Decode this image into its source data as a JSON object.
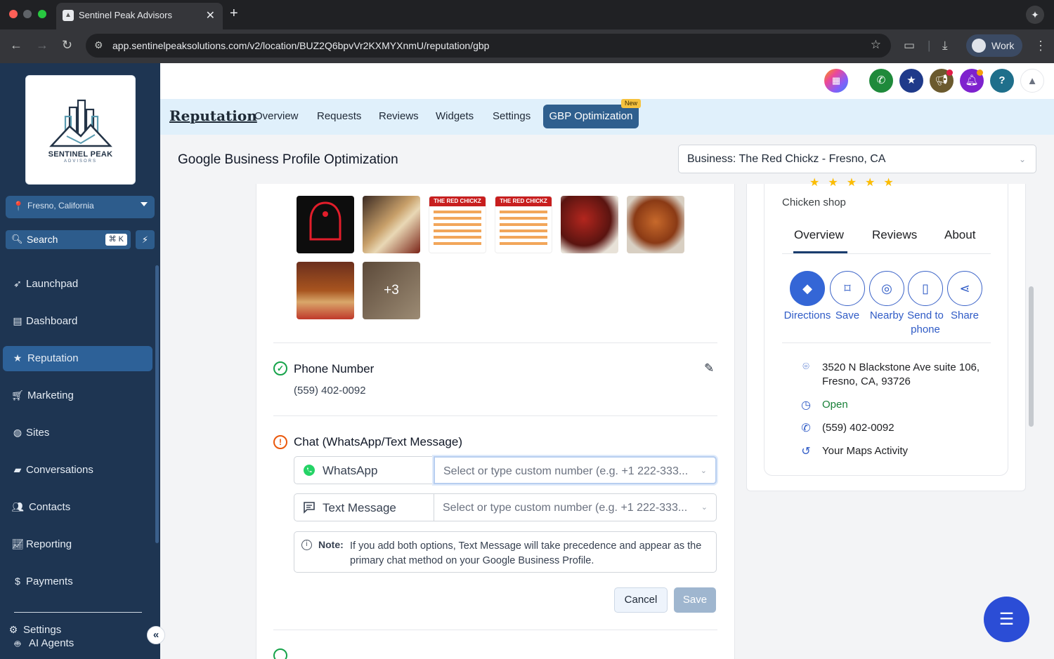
{
  "browser": {
    "tab_title": "Sentinel Peak Advisors",
    "url": "app.sentinelpeaksolutions.com/v2/location/BUZ2Q6bpvVr2KXMYXnmU/reputation/gbp",
    "profile_label": "Work"
  },
  "sidebar": {
    "logo_text": "SENTINEL PEAK",
    "logo_sub": "ADVISORS",
    "location": "Fresno, California",
    "search_label": "Search",
    "search_shortcut": "⌘ K",
    "items": [
      {
        "label": "Launchpad",
        "icon": "rocket-icon"
      },
      {
        "label": "Dashboard",
        "icon": "dashboard-icon"
      },
      {
        "label": "Reputation",
        "icon": "star-icon"
      },
      {
        "label": "Marketing",
        "icon": "cart-icon"
      },
      {
        "label": "Sites",
        "icon": "globe-icon"
      },
      {
        "label": "Conversations",
        "icon": "chat-icon"
      },
      {
        "label": "Contacts",
        "icon": "users-icon"
      },
      {
        "label": "Reporting",
        "icon": "chart-icon"
      },
      {
        "label": "Payments",
        "icon": "dollar-icon"
      }
    ],
    "settings_label": "Settings",
    "ai_agents_label": "AI Agents"
  },
  "subnav": {
    "title": "Reputation",
    "tabs": [
      "Overview",
      "Requests",
      "Reviews",
      "Widgets",
      "Settings"
    ],
    "active_tab": "GBP Optimization",
    "new_badge": "New"
  },
  "page": {
    "title": "Google Business Profile Optimization",
    "business_select": "Business: The Red Chickz - Fresno, CA"
  },
  "photos": {
    "more_count": "+3",
    "menu_label": "THE RED CHICKZ"
  },
  "phone_section": {
    "heading": "Phone Number",
    "value": "(559) 402-0092"
  },
  "chat_section": {
    "heading": "Chat (WhatsApp/Text Message)",
    "whatsapp_label": "WhatsApp",
    "text_label": "Text Message",
    "placeholder": "Select or type custom number (e.g. +1 222-333...",
    "note_label": "Note:",
    "note_text": "If you add both options, Text Message will take precedence and appear as the primary chat method on your Google Business Profile.",
    "cancel_label": "Cancel",
    "save_label": "Save"
  },
  "preview": {
    "category": "Chicken shop",
    "tabs": [
      "Overview",
      "Reviews",
      "About"
    ],
    "actions": [
      "Directions",
      "Save",
      "Nearby",
      "Send to phone",
      "Share"
    ],
    "address": "3520 N Blackstone Ave suite 106, Fresno, CA, 93726",
    "status": "Open",
    "status_color": "#188038",
    "phone": "(559) 402-0092",
    "activity": "Your Maps Activity"
  },
  "colors": {
    "sidebar_bg": "#1e3552",
    "accent": "#2f5f8e",
    "google_blue": "#3466d6"
  }
}
